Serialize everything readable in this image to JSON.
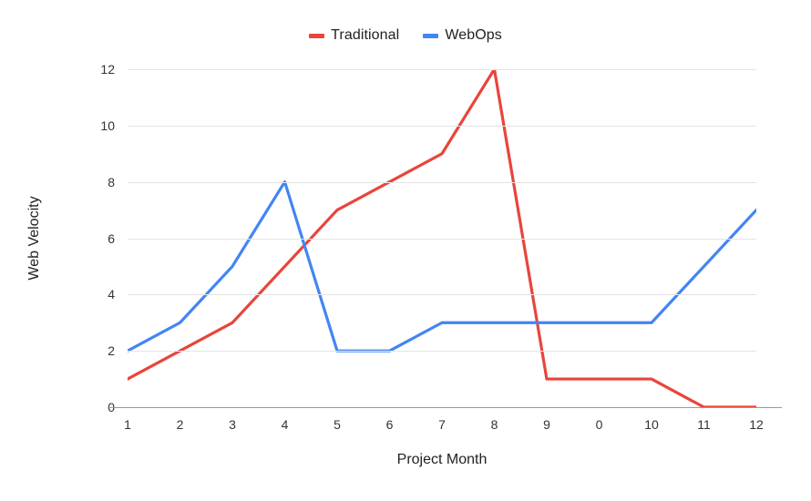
{
  "chart_data": {
    "type": "line",
    "title": "",
    "xlabel": "Project Month",
    "ylabel": "Web Velocity",
    "categories": [
      "1",
      "2",
      "3",
      "4",
      "5",
      "6",
      "7",
      "8",
      "9",
      "0",
      "10",
      "11",
      "12"
    ],
    "ylim": [
      0,
      12
    ],
    "yticks": [
      0,
      2,
      4,
      6,
      8,
      10,
      12
    ],
    "grid": true,
    "legend_position": "top-center",
    "series": [
      {
        "name": "Traditional",
        "color": "#e8453c",
        "values": [
          1,
          2,
          3,
          5,
          7,
          8,
          9,
          12,
          1,
          1,
          1,
          0,
          0
        ]
      },
      {
        "name": "WebOps",
        "color": "#4285f4",
        "values": [
          2,
          3,
          5,
          8,
          2,
          2,
          3,
          3,
          3,
          3,
          3,
          5,
          7
        ]
      }
    ]
  },
  "style": {
    "grid_color": "#e4e4e4",
    "axis_color": "#999999",
    "text_color": "#222222",
    "background": "#ffffff"
  }
}
